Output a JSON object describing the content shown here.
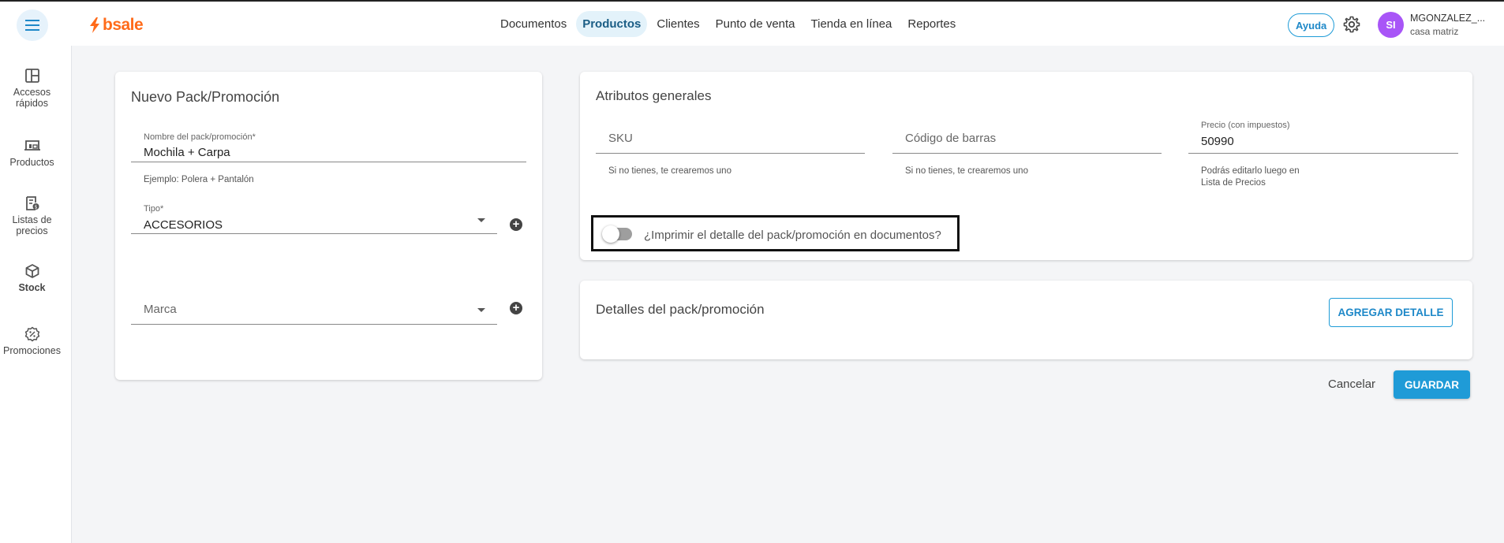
{
  "app": {
    "logo_text": "bsale",
    "brand_color": "#ff6b1a",
    "accent_color": "#1f9bd7"
  },
  "nav": {
    "items": [
      {
        "label": "Documentos"
      },
      {
        "label": "Productos",
        "active": true
      },
      {
        "label": "Clientes"
      },
      {
        "label": "Punto de venta"
      },
      {
        "label": "Tienda en línea"
      },
      {
        "label": "Reportes"
      }
    ]
  },
  "header": {
    "help_label": "Ayuda",
    "avatar_initials": "SI",
    "user_name": "MGONZALEZ_...",
    "user_location": "casa matriz"
  },
  "sidebar": {
    "items": [
      {
        "label": "Accesos rápidos",
        "icon": "layout-icon"
      },
      {
        "label": "Productos",
        "icon": "products-icon"
      },
      {
        "label": "Listas de precios",
        "icon": "price-list-icon"
      },
      {
        "label": "Stock",
        "icon": "box-icon"
      },
      {
        "label": "Promociones",
        "icon": "discount-icon"
      }
    ]
  },
  "pack_form": {
    "title": "Nuevo Pack/Promoción",
    "name_label": "Nombre del pack/promoción*",
    "name_value": "Mochila + Carpa",
    "name_helper": "Ejemplo: Polera + Pantalón",
    "type_label": "Tipo*",
    "type_value": "ACCESORIOS",
    "brand_placeholder": "Marca"
  },
  "attributes": {
    "title": "Atributos generales",
    "sku_placeholder": "SKU",
    "sku_helper": "Si no tienes, te crearemos uno",
    "barcode_placeholder": "Código de barras",
    "barcode_helper": "Si no tienes, te crearemos uno",
    "price_label": "Precio (con impuestos)",
    "price_value": "50990",
    "price_helper_line1": "Podrás editarlo luego en",
    "price_helper_line2": "Lista de Precios",
    "print_toggle_label": "¿Imprimir el detalle del pack/promoción en documentos?",
    "print_toggle_on": false
  },
  "details": {
    "title": "Detalles del pack/promoción",
    "add_label": "AGREGAR DETALLE"
  },
  "actions": {
    "cancel_label": "Cancelar",
    "save_label": "GUARDAR"
  }
}
